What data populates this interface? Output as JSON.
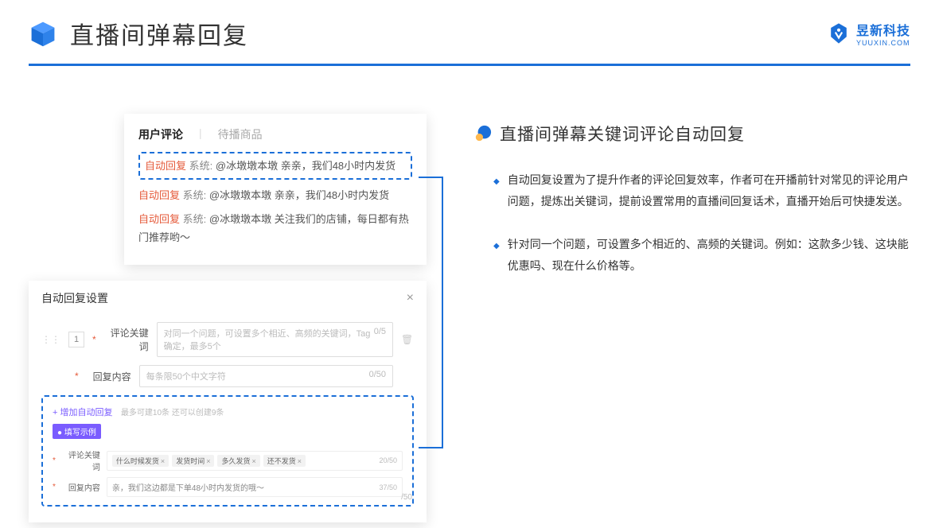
{
  "header": {
    "title": "直播间弹幕回复",
    "brand_cn": "昱新科技",
    "brand_en": "YUUXIN.COM"
  },
  "comment_card": {
    "tab_active": "用户评论",
    "tab_other": "待播商品",
    "lines": [
      {
        "tag": "自动回复",
        "sys": "系统:",
        "text": "@冰墩墩本墩 亲亲，我们48小时内发货"
      },
      {
        "tag": "自动回复",
        "sys": "系统:",
        "text": "@冰墩墩本墩 亲亲，我们48小时内发货"
      },
      {
        "tag": "自动回复",
        "sys": "系统:",
        "text": "@冰墩墩本墩 关注我们的店铺，每日都有热门推荐哟～"
      }
    ]
  },
  "settings": {
    "title": "自动回复设置",
    "row_num": "1",
    "label_keyword": "评论关键词",
    "placeholder_keyword": "对同一个问题，可设置多个相近、高频的关键词，Tag确定，最多5个",
    "count_keyword": "0/5",
    "label_content": "回复内容",
    "placeholder_content": "每条限50个中文字符",
    "count_content": "0/50",
    "add_link": "+ 增加自动回复",
    "add_hint": "最多可建10条 还可以创建9条",
    "badge": "● 填写示例",
    "ex_label_kw": "评论关键词",
    "ex_tags": [
      "什么时候发货",
      "发货时间",
      "多久发货",
      "还不发货"
    ],
    "ex_kw_count": "20/50",
    "ex_label_ct": "回复内容",
    "ex_content": "亲，我们这边都是下单48小时内发货的哦～",
    "ex_ct_count": "37/50",
    "outer_count": "/50"
  },
  "right": {
    "section_title": "直播间弹幕关键词评论自动回复",
    "bullets": [
      "自动回复设置为了提升作者的评论回复效率，作者可在开播前针对常见的评论用户问题，提炼出关键词，提前设置常用的直播间回复话术，直播开始后可快捷发送。",
      "针对同一个问题，可设置多个相近的、高频的关键词。例如：这款多少钱、这块能优惠吗、现在什么价格等。"
    ]
  }
}
